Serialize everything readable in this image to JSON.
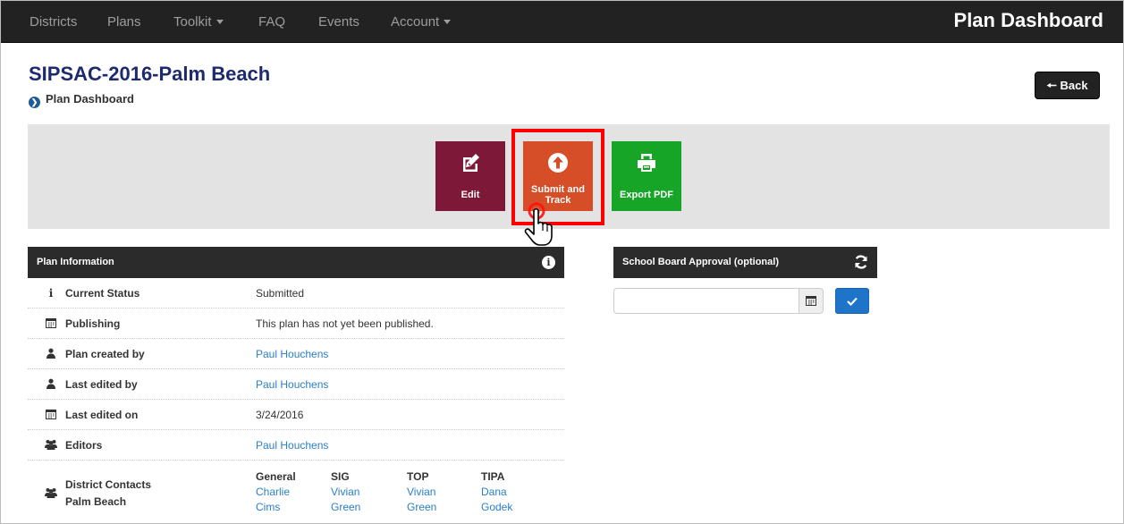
{
  "nav": {
    "items": [
      {
        "label": "Districts"
      },
      {
        "label": "Plans"
      },
      {
        "label": "Toolkit"
      },
      {
        "label": "FAQ"
      },
      {
        "label": "Events"
      },
      {
        "label": "Account"
      }
    ],
    "brand": "Plan Dashboard"
  },
  "header": {
    "title": "SIPSAC-2016-Palm Beach",
    "breadcrumb": "Plan Dashboard",
    "back_label": "Back"
  },
  "actions": {
    "edit": {
      "label": "Edit",
      "color": "#7d1838",
      "icon": "edit-icon"
    },
    "submit": {
      "label_line1": "Submit and",
      "label_line2": "Track",
      "color": "#d54e27",
      "icon": "upload-circle-icon"
    },
    "export": {
      "label": "Export PDF",
      "color": "#17a528",
      "icon": "printer-icon"
    }
  },
  "plan_info": {
    "title": "Plan Information",
    "rows": [
      {
        "icon": "info-icon",
        "label": "Current Status",
        "value": "Submitted"
      },
      {
        "icon": "calendar-icon",
        "label": "Publishing",
        "value": "This plan has not yet been published."
      },
      {
        "icon": "user-icon",
        "label": "Plan created by",
        "value": "Paul Houchens"
      },
      {
        "icon": "user-icon",
        "label": "Last edited by",
        "value": "Paul Houchens"
      },
      {
        "icon": "calendar-icon",
        "label": "Last edited on",
        "value": "3/24/2016"
      },
      {
        "icon": "users-icon",
        "label": "Editors",
        "value": "Paul Houchens"
      }
    ],
    "contacts": {
      "label_line1": "District Contacts",
      "label_line2": "Palm Beach",
      "columns": [
        {
          "head": "General",
          "first": "Charlie",
          "last": "Cims"
        },
        {
          "head": "SIG",
          "first": "Vivian",
          "last": "Green"
        },
        {
          "head": "TOP",
          "first": "Vivian",
          "last": "Green"
        },
        {
          "head": "TIPA",
          "first": "Dana",
          "last": "Godek"
        }
      ]
    }
  },
  "school_board": {
    "title": "School Board Approval (optional)",
    "date_value": ""
  }
}
